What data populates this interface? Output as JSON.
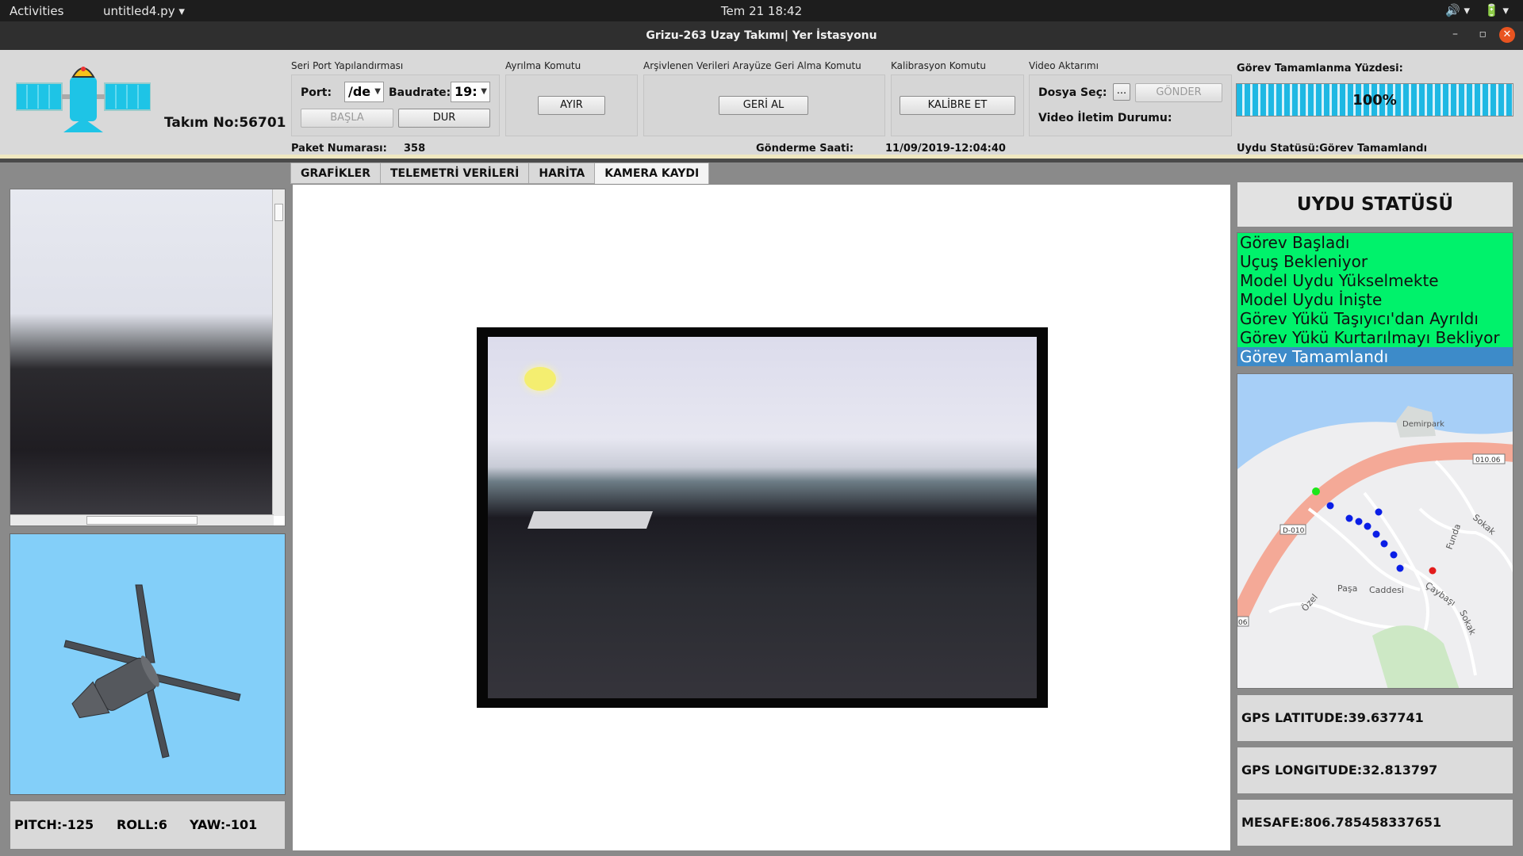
{
  "topbar": {
    "activities": "Activities",
    "app_menu": "untitled4.py ▾",
    "clock": "Tem 21  18:42",
    "tray": [
      "🔊 ▾",
      "🔋 ▾"
    ]
  },
  "window": {
    "title": "Grizu-263 Uzay Takımı| Yer İstasyonu",
    "minimize": "–",
    "maximize": "▫",
    "close": "✕"
  },
  "header": {
    "team_no": "Takım No:56701",
    "serial": {
      "group_label": "Seri Port Yapılandırması",
      "port_label": "Port:",
      "port_value": "/de",
      "baud_label": "Baudrate:",
      "baud_value": "19:",
      "start_button": "BAŞLA",
      "stop_button": "DUR"
    },
    "separation": {
      "group_label": "Ayrılma Komutu",
      "button": "AYIR"
    },
    "archive": {
      "group_label": "Arşivlenen Verileri Arayüze Geri Alma Komutu",
      "button": "GERİ AL"
    },
    "calibration": {
      "group_label": "Kalibrasyon Komutu",
      "button": "KALİBRE ET"
    },
    "video": {
      "group_label": "Video Aktarımı",
      "file_label": "Dosya Seç:",
      "browse_button": "...",
      "send_button": "GÖNDER",
      "status_label": "Video İletim Durumu:"
    },
    "progress": {
      "label": "Görev Tamamlanma Yüzdesi:",
      "value_text": "100%",
      "fraction": 1.0
    },
    "packet_label": "Paket Numarası:",
    "packet_value": "358",
    "send_time_label": "Gönderme Saati:",
    "send_time_value": "11/09/2019-12:04:40",
    "satellite_status": "Uydu Statüsü:Görev Tamamlandı"
  },
  "tabs": [
    {
      "label": "GRAFİKLER"
    },
    {
      "label": "TELEMETRİ VERİLERİ"
    },
    {
      "label": "HARİTA"
    },
    {
      "label": "KAMERA KAYDI"
    }
  ],
  "active_tab": "KAMERA KAYDI",
  "attitude": {
    "pitch": "PITCH:-125",
    "roll": "ROLL:6",
    "yaw": "YAW:-101"
  },
  "status_panel": {
    "title": "UYDU STATÜSÜ",
    "items": [
      "Görev Başladı",
      "Uçuş Bekleniyor",
      "Model Uydu Yükselmekte",
      "Model Uydu İnişte",
      "Görev Yükü Taşıyıcı'dan Ayrıldı",
      "Görev Yükü Kurtarılmayı Bekliyor",
      "Görev Tamamlandı"
    ],
    "selected": "Görev Tamamlandı",
    "list_color": "#00f26b",
    "selected_color": "#3d8bc9"
  },
  "map": {
    "labels": {
      "demirpark": "Demirpark",
      "road1": "010.06",
      "road2": "D-010",
      "road3": "06",
      "funda": "Funda",
      "sokak1": "Sokak",
      "pasa": "Paşa",
      "caddesi": "Caddesi",
      "ozel": "Özel",
      "caybasi": "Çaybaşı",
      "sokak2": "Sokak"
    }
  },
  "gps": {
    "latitude": "GPS LATITUDE:39.637741",
    "longitude": "GPS LONGITUDE:32.813797",
    "distance": "MESAFE:806.785458337651"
  }
}
